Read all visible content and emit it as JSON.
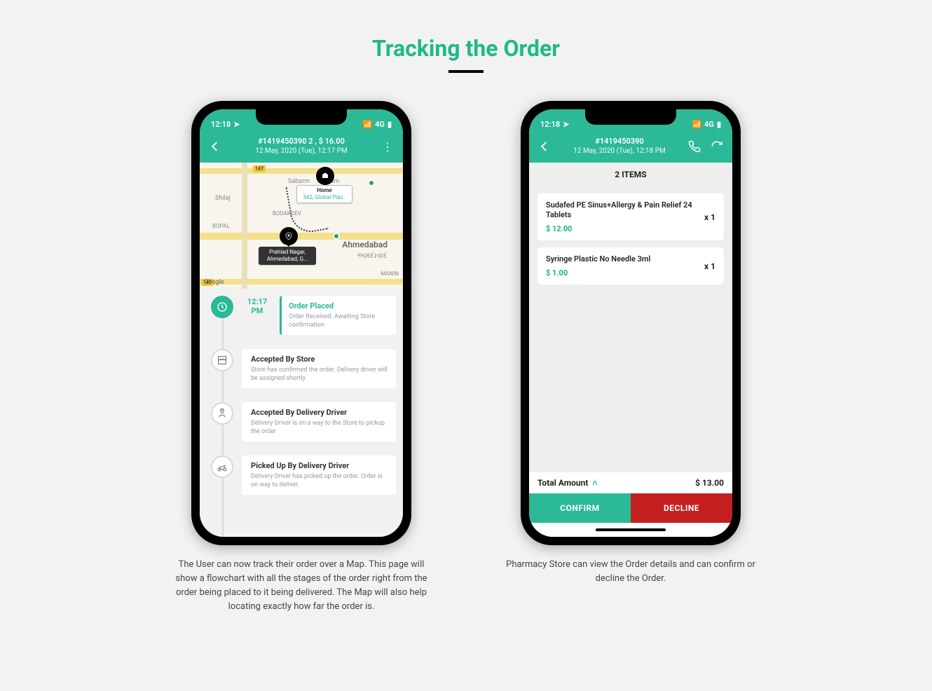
{
  "page": {
    "title": "Tracking the Order"
  },
  "status": {
    "time": "12:18",
    "network": "4G"
  },
  "phone1": {
    "header": {
      "title": "#1419450390 2 , $ 16.00",
      "subtitle": "12 May, 2020 (Tue),  12:17 PM"
    },
    "map": {
      "home_label": "Home",
      "home_addr": "342, Global Plaz..",
      "src_line1": "Prahlad Nagar,",
      "src_line2": "Ahmedabad, G...",
      "city": "Ahmedabad",
      "city_native": "અમદાવાદ",
      "google": "Google",
      "label_shilaj": "Shilaj",
      "label_bopal": "BOPAL",
      "label_ashram": "Sabarm     Ashram",
      "label_bodakdev": "BODAKDEV",
      "label_manin": "MANIN",
      "badge1": "147",
      "badge2": "147"
    },
    "steps": [
      {
        "time": "12:17 PM",
        "title": "Order Placed",
        "desc": "Order Received. Awaiting Store confirmation",
        "active": true,
        "icon": "clock"
      },
      {
        "title": "Accepted By Store",
        "desc": "Store has confirmed the order. Delivery driver will be assigned shortly",
        "icon": "store"
      },
      {
        "title": "Accepted By Delivery Driver",
        "desc": "Delivery Driver is on a way to the Store to pickup the order",
        "icon": "driver"
      },
      {
        "title": "Picked Up By Delivery Driver",
        "desc": "Delivery Driver has picked up the order. Order is on way to deliver.",
        "icon": "scooter"
      }
    ],
    "caption": "The User can now track their order over a Map. This page will show a flowchart with all the stages of the order right from the order being placed to it being delivered. The Map will also help locating exactly how far the order is."
  },
  "phone2": {
    "header": {
      "title": "#1419450390",
      "subtitle": "12 May, 2020 (Tue),  12:18 PM"
    },
    "items_header": "2 ITEMS",
    "items": [
      {
        "name": "Sudafed PE Sinus+Allergy & Pain Relief 24 Tablets",
        "price": "$ 12.00",
        "qty": "x 1"
      },
      {
        "name": "Syringe Plastic No Needle 3ml",
        "price": "$ 1.00",
        "qty": "x 1"
      }
    ],
    "total_label": "Total Amount",
    "total_value": "$ 13.00",
    "confirm": "CONFIRM",
    "decline": "DECLINE",
    "caption": "Pharmacy Store can view the Order details and can confirm or decline the Order."
  }
}
